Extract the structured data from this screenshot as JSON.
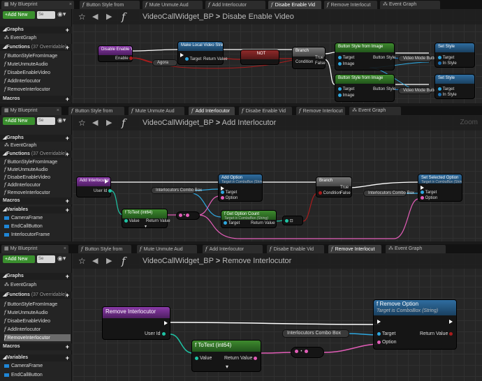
{
  "panels": [
    {
      "tabs": [
        "My Blueprint",
        "Button Style from",
        "Mute Unmute Aud",
        "Add Interlocutor",
        "Disabe Enable Vid",
        "Remove Interlocut",
        "Event Graph"
      ],
      "active_tab": 4,
      "breadcrumb": {
        "widget": "VideoCallWidget_BP",
        "sep": ">",
        "graph": "Disabe Enable Video"
      },
      "sidebar": {
        "add_new": "+Add New",
        "search": "Se",
        "graphs": "Graphs",
        "event_graph": "EventGraph",
        "functions": "Functions",
        "functions_count": "(37 Overridable)",
        "items": [
          "ButtonStyleFromImage",
          "MuteUnmuteAudio",
          "DisabeEnableVideo",
          "AddInterlocutor",
          "RemoveInterlocutor"
        ],
        "macros": "Macros"
      },
      "nodes": {
        "entry": "Disable Enable Video",
        "entry_pin": "Enable",
        "get_style": "Make Local Video Stream",
        "get_style_target": "Target",
        "get_style_ret": "Return Value",
        "not": "NOT",
        "branch": "Branch",
        "cond": "Condition",
        "true": "True",
        "false": "False",
        "bsfi1": "Button Style from Image",
        "bsfi2": "Button Style from Image",
        "set1": "Set Style",
        "set2": "Set Style",
        "target": "Target",
        "image": "Image",
        "button_style": "Button Style",
        "in_style": "In Style",
        "video_mode": "Video Mode Button",
        "agora": "Agora"
      }
    },
    {
      "tabs": [
        "My Blueprint",
        "Button Style from",
        "Mute Unmute Aud",
        "Add Interlocutor",
        "Disabe Enable Vid",
        "Remove Interlocut",
        "Event Graph"
      ],
      "active_tab": 3,
      "breadcrumb": {
        "widget": "VideoCallWidget_BP",
        "sep": ">",
        "graph": "Add Interlocutor",
        "zoom": "Zoom"
      },
      "sidebar": {
        "add_new": "+Add New",
        "search": "Se",
        "graphs": "Graphs",
        "event_graph": "EventGraph",
        "functions": "Functions",
        "functions_count": "(37 Overridable)",
        "items": [
          "ButtonStyleFromImage",
          "MuteUnmuteAudio",
          "DisabeEnableVideo",
          "AddInterlocutor",
          "RemoveInterlocutor"
        ],
        "macros": "Macros",
        "variables": "Variables",
        "vars": [
          "CameraFrame",
          "EndCallButton",
          "InterlocutorFrame"
        ]
      },
      "nodes": {
        "entry": "Add Interlocutor",
        "user_id": "User Id",
        "add_option": "Add Option",
        "add_option_sub": "Target is ComboBox (String)",
        "combo": "Interlocutors Combo Box",
        "totext": "ToText (int64)",
        "value": "Value",
        "ret": "Return Value",
        "get_count": "Get Option Count",
        "get_count_sub": "Target is ComboBox (String)",
        "branch": "Branch",
        "cond": "Condition",
        "true": "True",
        "false": "False",
        "set_sel": "Set Selected Option",
        "set_sel_sub": "Target is ComboBox (String)",
        "target": "Target",
        "option": "Option",
        "combo2": "Interlocutors Combo Box"
      }
    },
    {
      "tabs": [
        "My Blueprint",
        "Button Style from",
        "Mute Unmute Aud",
        "Add Interlocutor",
        "Disabe Enable Vid",
        "Remove Interlocut",
        "Event Graph"
      ],
      "active_tab": 5,
      "breadcrumb": {
        "widget": "VideoCallWidget_BP",
        "sep": ">",
        "graph": "Remove Interlocutor"
      },
      "sidebar": {
        "add_new": "+Add New",
        "search": "Se",
        "graphs": "Graphs",
        "event_graph": "EventGraph",
        "functions": "Functions",
        "functions_count": "(37 Overridable)",
        "items": [
          "ButtonStyleFromImage",
          "MuteUnmuteAudio",
          "DisabeEnableVideo",
          "AddInterlocutor",
          "RemoveInterlocutor"
        ],
        "macros": "Macros",
        "variables": "Variables",
        "vars": [
          "CameraFrame",
          "EndCallButton"
        ]
      },
      "nodes": {
        "entry": "Remove Interlocutor",
        "user_id": "User Id",
        "totext": "ToText (int64)",
        "value": "Value",
        "ret": "Return Value",
        "combo": "Interlocutors Combo Box",
        "remove": "Remove Option",
        "remove_sub": "Target is ComboBox (String)",
        "target": "Target",
        "option": "Option",
        "remove_ret": "Return Value"
      }
    }
  ],
  "colors": {
    "exec": "#ffffff",
    "int64": "#1fc3a4",
    "text": "#e35db8",
    "object": "#2fa8e0",
    "bool": "#a81c1c",
    "struct": "#1a6fb5"
  }
}
